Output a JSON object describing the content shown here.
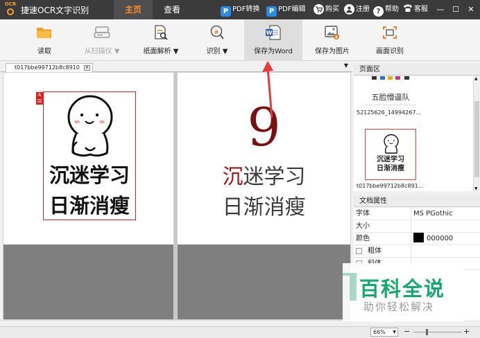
{
  "titlebar": {
    "logo_text": "OCR",
    "app_title": "捷速OCR文字识别",
    "tabs": [
      {
        "label": "主页",
        "active": true
      },
      {
        "label": "查看",
        "active": false
      }
    ],
    "pdf_convert": "PDF转换",
    "pdf_edit": "PDF编辑",
    "buy": "购买",
    "register": "注册",
    "help": "帮助",
    "service": "客服",
    "pdf_icon_letter": "P",
    "help_icon": "?",
    "accent_color": "#ff8d2a"
  },
  "ribbon": {
    "buttons": [
      {
        "label": "读取",
        "icon": "folder-icon",
        "enabled": true
      },
      {
        "label": "从扫描仪 ▼",
        "icon": "scanner-icon",
        "enabled": false
      },
      {
        "label": "纸面解析 ▼",
        "icon": "page-analysis-icon",
        "enabled": true
      },
      {
        "label": "识别 ▼",
        "icon": "recognize-icon",
        "enabled": true
      },
      {
        "label": "保存为Word",
        "icon": "word-icon",
        "enabled": true,
        "hovered": true
      },
      {
        "label": "保存为图片",
        "icon": "image-icon",
        "enabled": true
      },
      {
        "label": "画面识别",
        "icon": "screen-capture-icon",
        "enabled": true
      }
    ]
  },
  "document": {
    "tab_name": "t017bbe99712b8c8910",
    "source": {
      "region_tag": "A",
      "line1": "沉迷学习",
      "line2": "日渐消瘦"
    },
    "result": {
      "number": "9",
      "line1_first_char": "沉",
      "line1_rest": "迷学习",
      "line2": "日渐消瘦"
    }
  },
  "page_area": {
    "title": "页面区",
    "thumbnails": [
      {
        "name": "52125626_14994267...",
        "caption": "五脸懵逼队"
      },
      {
        "name": "t017bbe99712b8c891...",
        "caption_line1": "沉迷学习",
        "caption_line2": "日渐消瘦",
        "selected": true
      }
    ]
  },
  "doc_props": {
    "title": "文档属性",
    "rows": [
      {
        "key": "字体",
        "value": "MS PGothic"
      },
      {
        "key": "大小",
        "value": ""
      },
      {
        "key": "颜色",
        "value": "000000",
        "swatch": "#000000"
      }
    ],
    "checkboxes": [
      {
        "label": "粗体",
        "checked": false
      },
      {
        "label": "斜体",
        "checked": false
      }
    ]
  },
  "statusbar": {
    "zoom": "66%",
    "zoom_out": "−",
    "zoom_in": "+"
  },
  "watermark": {
    "big": "百科全说",
    "small": "助你轻松解决"
  }
}
